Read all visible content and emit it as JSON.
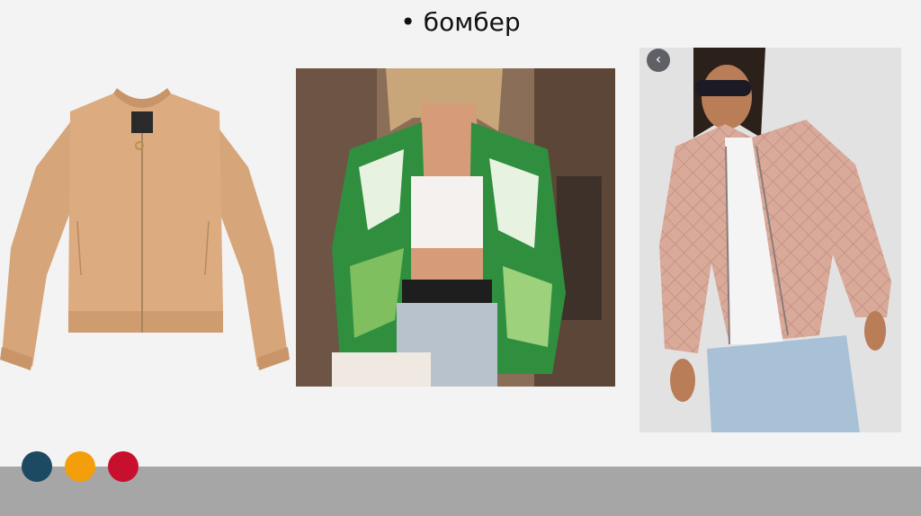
{
  "slide": {
    "title": "• бомбер",
    "background": "#f3f3f3",
    "footer_color": "#a6a6a6"
  },
  "dots": [
    {
      "name": "dot-navy",
      "color": "#1d4a63"
    },
    {
      "name": "dot-orange",
      "color": "#f59e0b"
    },
    {
      "name": "dot-crimson",
      "color": "#c8102e"
    }
  ],
  "gallery": {
    "prev_icon": "chevron-left-icon",
    "prev_glyph": "‹"
  }
}
